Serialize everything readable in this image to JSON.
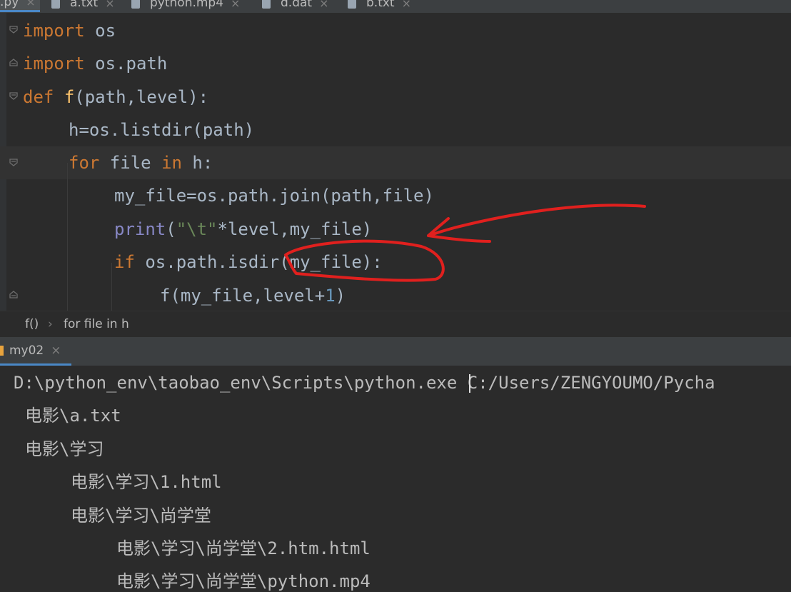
{
  "tabs": [
    {
      "label": ".py",
      "active": true
    },
    {
      "label": "a.txt",
      "active": false
    },
    {
      "label": "python.mp4",
      "active": false
    },
    {
      "label": "d.dat",
      "active": false
    },
    {
      "label": "b.txt",
      "active": false
    }
  ],
  "code": {
    "line1": {
      "kw": "import",
      "rest": " os"
    },
    "line2": {
      "kw": "import",
      "rest": " os.path"
    },
    "line3": {
      "kw": "def",
      "fn": "f",
      "rest": "(path,level):"
    },
    "line4": {
      "text": "h=os.listdir(path)"
    },
    "line5": {
      "kw1": "for",
      "mid": " file ",
      "kw2": "in",
      "rest": " h:"
    },
    "line6": {
      "text": "my_file=os.path.join(path,file)"
    },
    "line7": {
      "builtin": "print",
      "p1": "(",
      "str": "\"\\t\"",
      "rest": "*level,my_file)"
    },
    "line8": {
      "kw": "if",
      "rest": " os.path.isdir(my_file):"
    },
    "line9": {
      "pre": "f(my_file,level+",
      "num": "1",
      "post": ")"
    }
  },
  "breadcrumbs": {
    "first": "f()",
    "sep": "›",
    "second": "for file in h"
  },
  "run": {
    "tab_label": "my02",
    "close": "×"
  },
  "console": {
    "lines": [
      "D:\\python_env\\taobao_env\\Scripts\\python.exe C:/Users/ZENGYOUMO/Pycha",
      "电影\\a.txt",
      "电影\\学习",
      "电影\\学习\\1.html",
      "电影\\学习\\尚学堂",
      "电影\\学习\\尚学堂\\2.htm.html",
      "电影\\学习\\尚学堂\\python.mp4"
    ]
  },
  "colors": {
    "keyword": "#cc7832",
    "function": "#ffc66d",
    "string": "#6a8759",
    "number": "#6897bb",
    "builtin": "#8888c6",
    "annotation": "#e0201e"
  }
}
